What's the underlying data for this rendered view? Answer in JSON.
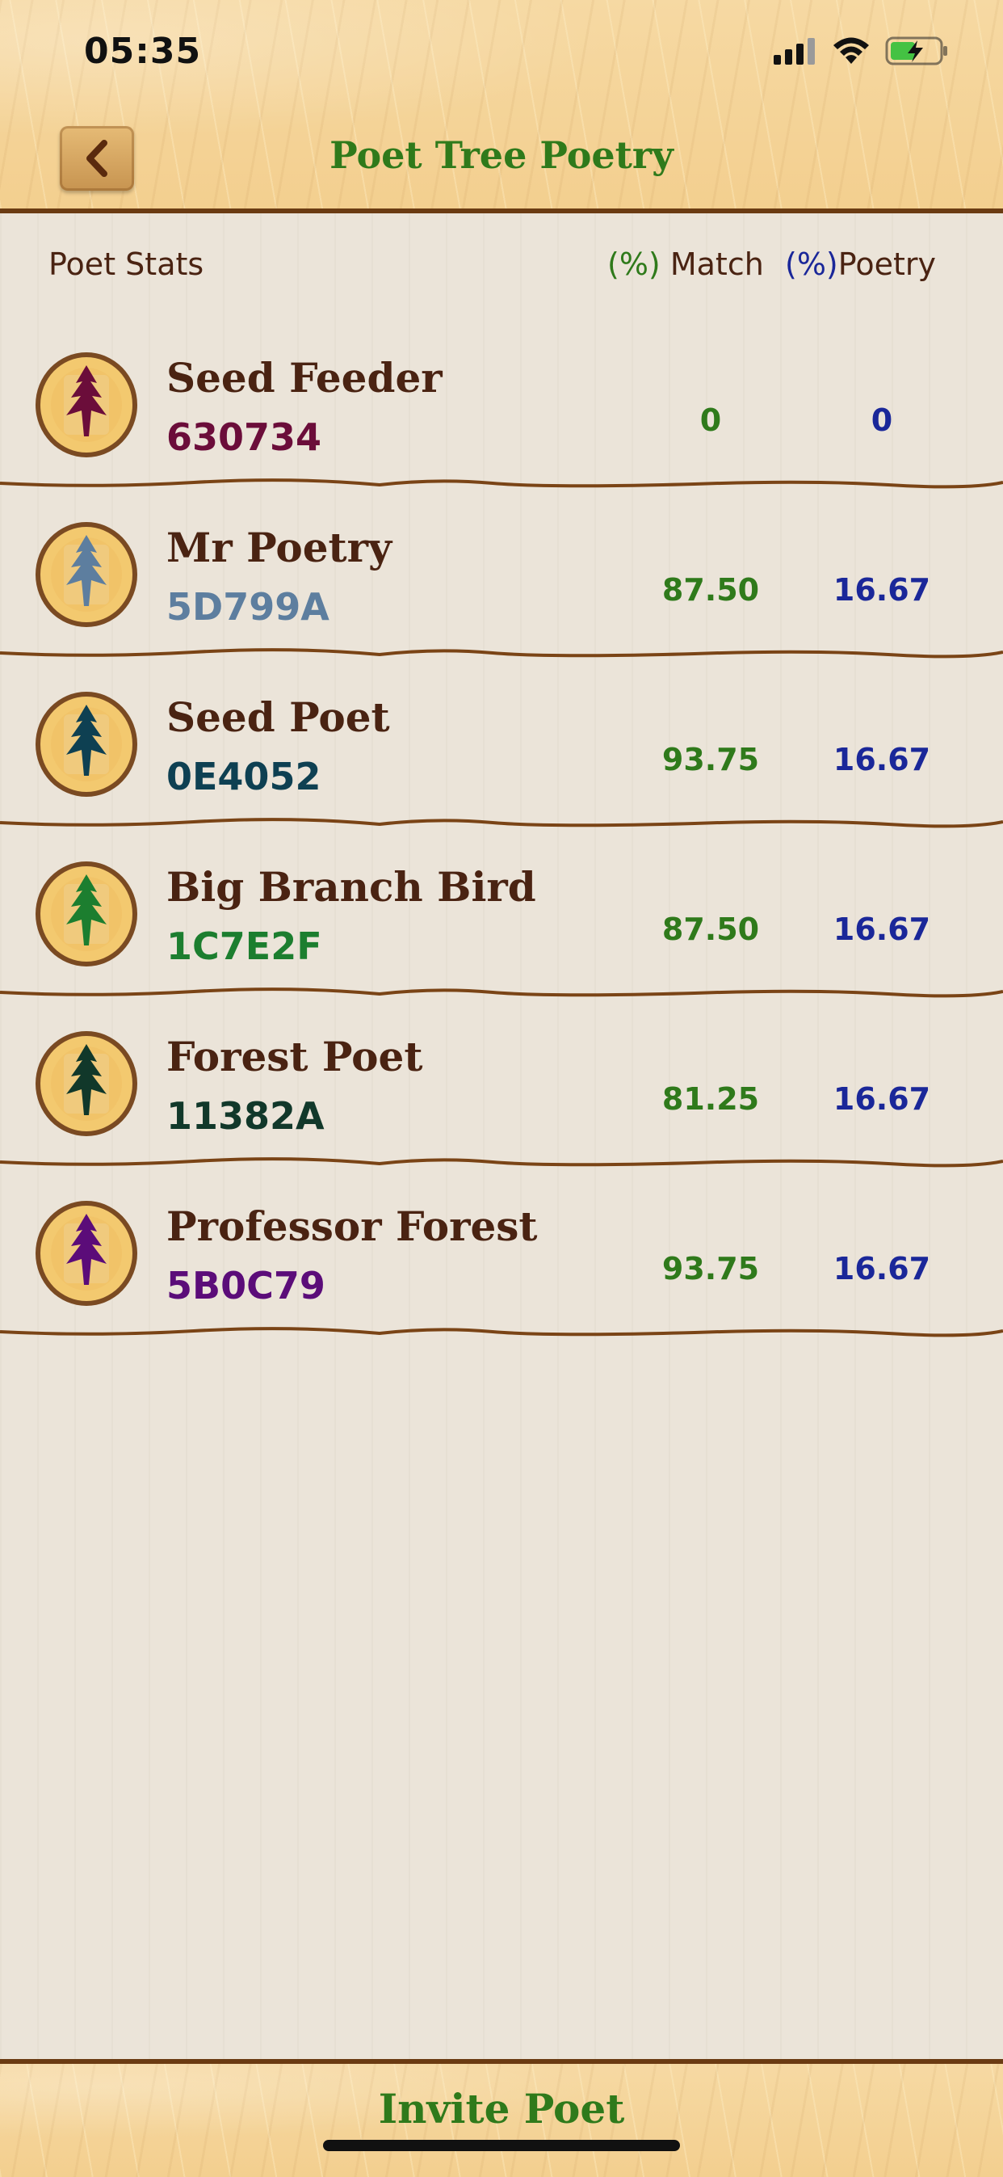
{
  "status_bar": {
    "time": "05:35",
    "icons": [
      "signal-icon",
      "wifi-icon",
      "battery-charging-icon"
    ]
  },
  "header": {
    "title": "Poet Tree Poetry",
    "back_icon": "chevron-left-icon"
  },
  "table": {
    "left_header": "Poet Stats",
    "match_header_pct": "(%)",
    "match_header_label": "Match",
    "poetry_header_pct": "(%)",
    "poetry_header_label": "Poetry",
    "rows": [
      {
        "name": "Seed Feeder",
        "code": "630734",
        "match": "0",
        "poetry": "0",
        "color": "#6b0d3a"
      },
      {
        "name": "Mr Poetry",
        "code": "5D799A",
        "match": "87.50",
        "poetry": "16.67",
        "color": "#5d7e9f"
      },
      {
        "name": "Seed Poet",
        "code": "0E4052",
        "match": "93.75",
        "poetry": "16.67",
        "color": "#0e4052"
      },
      {
        "name": "Big Branch Bird",
        "code": "1C7E2F",
        "match": "87.50",
        "poetry": "16.67",
        "color": "#1c7e2f"
      },
      {
        "name": "Forest Poet",
        "code": "11382A",
        "match": "81.25",
        "poetry": "16.67",
        "color": "#11382a"
      },
      {
        "name": "Professor Forest",
        "code": "5B0C79",
        "match": "93.75",
        "poetry": "16.67",
        "color": "#5b0c79"
      }
    ]
  },
  "colors": {
    "brand_green": "#2f7a1b",
    "poetry_blue": "#1a2799",
    "wood_brown": "#6b3b12",
    "text_brown": "#4a2312"
  },
  "footer": {
    "invite_label": "Invite Poet"
  }
}
